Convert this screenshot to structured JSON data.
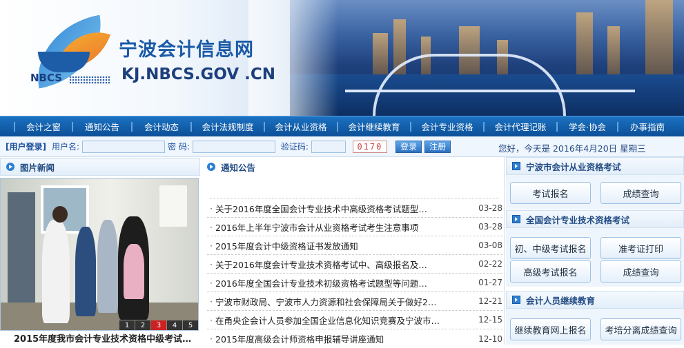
{
  "header": {
    "logo_text": "NBCS",
    "site_title": "宁波会计信息网",
    "site_url": "KJ.NBCS.GOV .CN"
  },
  "nav": {
    "items": [
      "会计之窗",
      "通知公告",
      "会计动态",
      "会计法规制度",
      "会计从业资格",
      "会计继续教育",
      "会计专业资格",
      "会计代理记账",
      "学会·协会",
      "办事指南"
    ]
  },
  "login": {
    "title": "[用户登录]",
    "username_label": "用户名:",
    "password_label": "密  码:",
    "captcha_label": "验证码:",
    "captcha_value": "0170",
    "login_button": "登录",
    "register_button": "注册",
    "greeting": "您好，今天是  2016年4月20日  星期三"
  },
  "photo_news": {
    "title": "图片新闻",
    "caption": "2015年度我市会计专业技术资格中级考试…",
    "pages": [
      "1",
      "2",
      "3",
      "4",
      "5"
    ],
    "active_page": "3"
  },
  "notices": {
    "title": "通知公告",
    "items": [
      {
        "title": "关于2016年度全国会计专业技术中高级资格考试题型…",
        "date": "03-28"
      },
      {
        "title": "2016年上半年宁波市会计从业资格考试考生注意事项",
        "date": "03-28"
      },
      {
        "title": "2015年度会计中级资格证书发放通知",
        "date": "03-08"
      },
      {
        "title": "关于2016年度会计专业技术资格考试中、高级报名及…",
        "date": "02-22"
      },
      {
        "title": "2016年度全国会计专业技术初级资格考试题型等问题…",
        "date": "01-27"
      },
      {
        "title": "宁波市财政局、宁波市人力资源和社会保障局关于做好2…",
        "date": "12-21"
      },
      {
        "title": "在甬央企会计人员参加全国企业信息化知识竞赛及宁波市…",
        "date": "12-15"
      },
      {
        "title": "2015年度高级会计师资格申报辅导讲座通知",
        "date": "12-10"
      }
    ]
  },
  "right": {
    "sec1_title": "宁波市会计从业资格考试",
    "sec1_buttons": [
      "考试报名",
      "成绩查询"
    ],
    "sec2_title": "全国会计专业技术资格考试",
    "sec2_buttons": [
      "初、中级考试报名",
      "准考证打印",
      "高级考试报名",
      "成绩查询"
    ],
    "sec3_title": "会计人员继续教育",
    "sec3_buttons": [
      "继续教育网上报名",
      "考培分离成绩查询"
    ]
  },
  "colors": {
    "accent": "#1b72c2",
    "nav_dark": "#0c4f97",
    "captcha_border": "#cc8888"
  }
}
